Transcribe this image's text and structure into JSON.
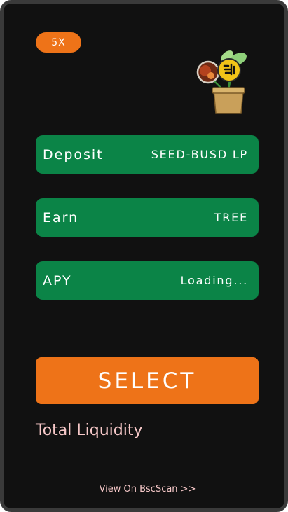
{
  "pool": {
    "multiplier": "5X",
    "icon": "seed-plant-pot-icon",
    "rows": [
      {
        "label": "Deposit",
        "value": "SEED-BUSD LP"
      },
      {
        "label": "Earn",
        "value": "TREE"
      },
      {
        "label": "APY",
        "value": "Loading..."
      }
    ],
    "select_label": "SELECT",
    "total_liquidity_label": "Total Liquidity",
    "bscscan_link": "View On BscScan >>"
  },
  "colors": {
    "card_bg": "#111111",
    "accent_orange": "#ee7318",
    "row_green": "#0b8447",
    "pink_text": "#f6c8c8"
  }
}
